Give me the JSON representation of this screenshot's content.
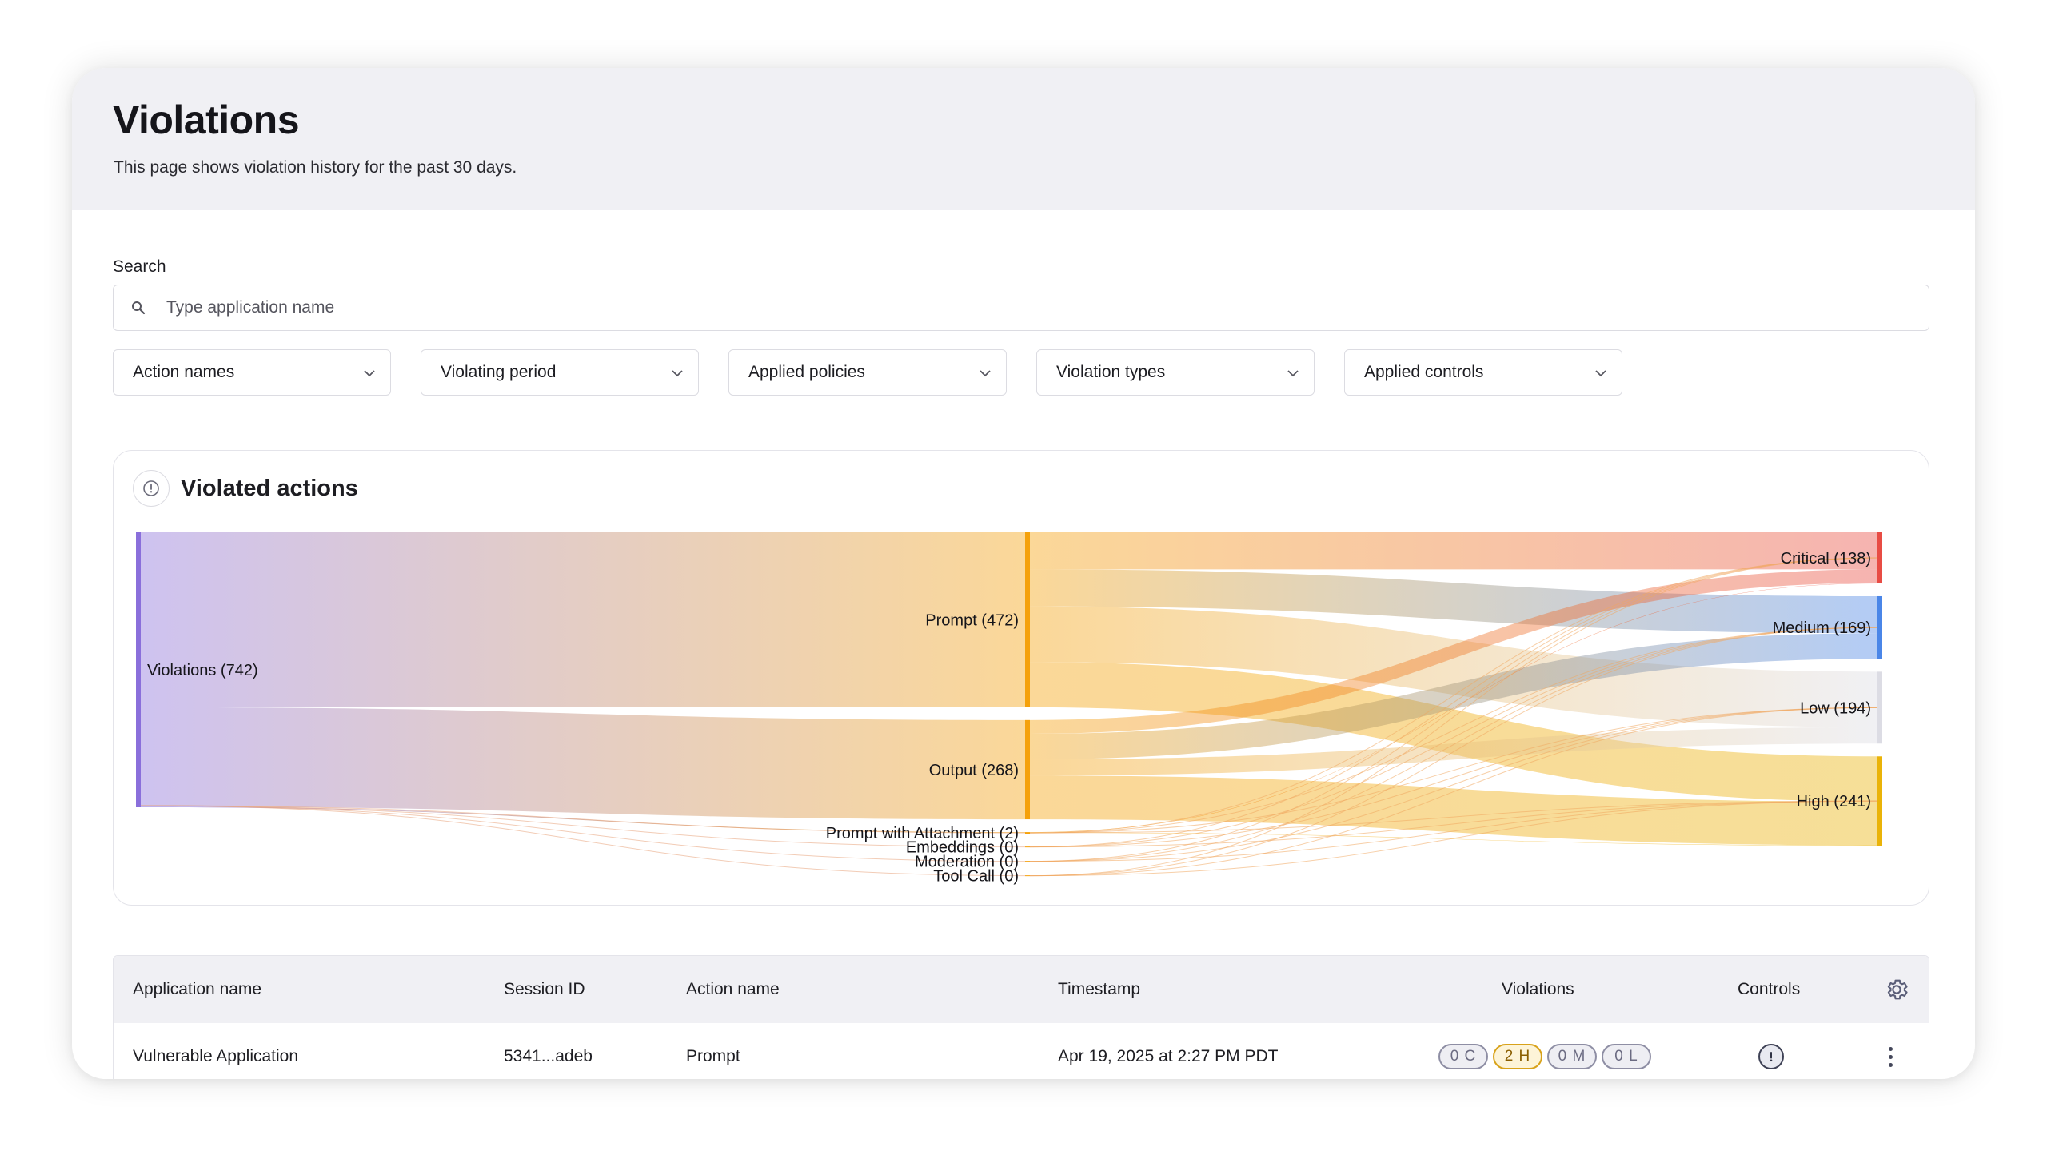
{
  "page": {
    "title": "Violations",
    "subtitle": "This page shows violation history for the past 30 days."
  },
  "search": {
    "label": "Search",
    "placeholder": "Type application name",
    "icon": "search-icon"
  },
  "filters": [
    {
      "label": "Action names"
    },
    {
      "label": "Violating period"
    },
    {
      "label": "Applied policies"
    },
    {
      "label": "Violation types"
    },
    {
      "label": "Applied controls"
    }
  ],
  "chart_card": {
    "title": "Violated actions",
    "icon": "info-icon"
  },
  "chart_data": {
    "type": "sankey",
    "nodes": [
      {
        "id": "violations",
        "label": "Violations (742)",
        "value": 742,
        "column": 0,
        "color": "#8a6fdb"
      },
      {
        "id": "prompt",
        "label": "Prompt (472)",
        "value": 472,
        "column": 1,
        "color": "#f5a10a"
      },
      {
        "id": "output",
        "label": "Output (268)",
        "value": 268,
        "column": 1,
        "color": "#f5a10a"
      },
      {
        "id": "prompt_attach",
        "label": "Prompt with Attachment (2)",
        "value": 2,
        "column": 1,
        "color": "#f5a10a"
      },
      {
        "id": "embeddings",
        "label": "Embeddings (0)",
        "value": 0,
        "column": 1,
        "color": "#f5a10a"
      },
      {
        "id": "moderation",
        "label": "Moderation (0)",
        "value": 0,
        "column": 1,
        "color": "#f5a10a"
      },
      {
        "id": "toolcall",
        "label": "Tool Call (0)",
        "value": 0,
        "column": 1,
        "color": "#f5a10a"
      },
      {
        "id": "critical",
        "label": "Critical (138)",
        "value": 138,
        "column": 2,
        "color": "#e84c44"
      },
      {
        "id": "medium",
        "label": "Medium (169)",
        "value": 169,
        "column": 2,
        "color": "#4a86e8"
      },
      {
        "id": "low",
        "label": "Low (194)",
        "value": 194,
        "column": 2,
        "color": "#dcdce4"
      },
      {
        "id": "high",
        "label": "High (241)",
        "value": 241,
        "column": 2,
        "color": "#eab308"
      }
    ],
    "links": [
      {
        "source": "violations",
        "target": "prompt",
        "value": 472
      },
      {
        "source": "violations",
        "target": "output",
        "value": 268
      },
      {
        "source": "violations",
        "target": "prompt_attach",
        "value": 2
      },
      {
        "source": "prompt",
        "target": "critical",
        "value": 100
      },
      {
        "source": "prompt",
        "target": "medium",
        "value": 100
      },
      {
        "source": "prompt",
        "target": "low",
        "value": 150
      },
      {
        "source": "prompt",
        "target": "high",
        "value": 122
      },
      {
        "source": "output",
        "target": "critical",
        "value": 37
      },
      {
        "source": "output",
        "target": "medium",
        "value": 69
      },
      {
        "source": "output",
        "target": "low",
        "value": 44
      },
      {
        "source": "output",
        "target": "high",
        "value": 118
      },
      {
        "source": "prompt_attach",
        "target": "critical",
        "value": 1
      },
      {
        "source": "prompt_attach",
        "target": "high",
        "value": 1
      }
    ]
  },
  "table": {
    "columns": [
      "Application name",
      "Session ID",
      "Action name",
      "Timestamp",
      "Violations",
      "Controls"
    ],
    "rows": [
      {
        "application": "Vulnerable Application",
        "session_id": "5341...adeb",
        "action": "Prompt",
        "timestamp": "Apr 19, 2025 at 2:27 PM PDT",
        "violations": [
          "0 C",
          "2 H",
          "0 M",
          "0 L"
        ],
        "controls_icon": "alert-circle-icon"
      }
    ]
  }
}
